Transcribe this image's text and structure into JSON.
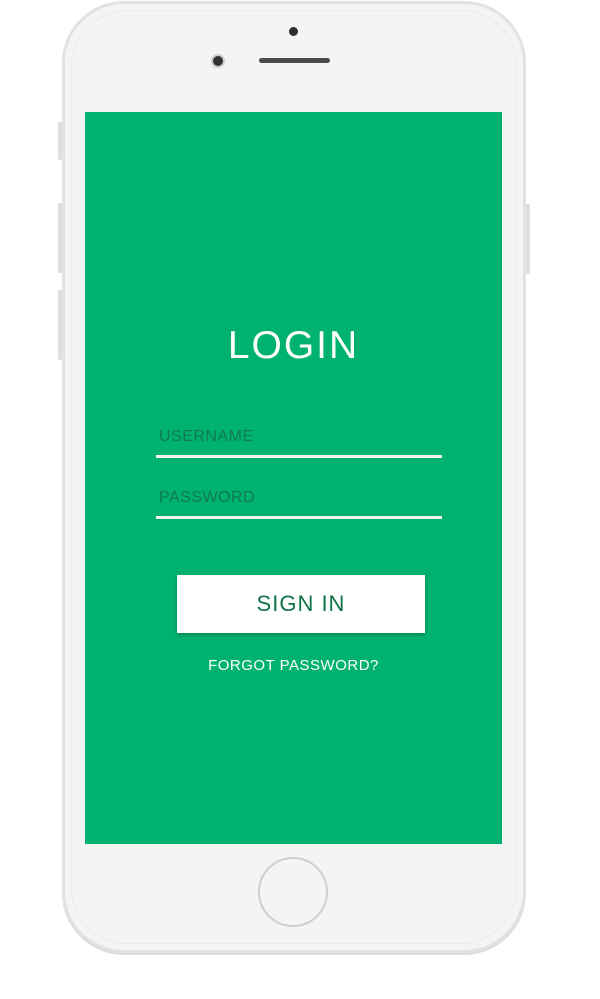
{
  "screen": {
    "background_color": "#00b26f",
    "title": "LOGIN",
    "username": {
      "placeholder": "USERNAME",
      "value": ""
    },
    "password": {
      "placeholder": "PASSWORD",
      "value": ""
    },
    "sign_in_label": "SIGN IN",
    "forgot_password_label": "FORGOT PASSWORD?"
  },
  "colors": {
    "accent": "#00b26f",
    "button_text": "#0e7346",
    "phone_body": "#f4f4f4"
  },
  "icons": {
    "camera": "front-camera-icon",
    "speaker": "earpiece-speaker-icon",
    "home": "home-button-icon"
  }
}
